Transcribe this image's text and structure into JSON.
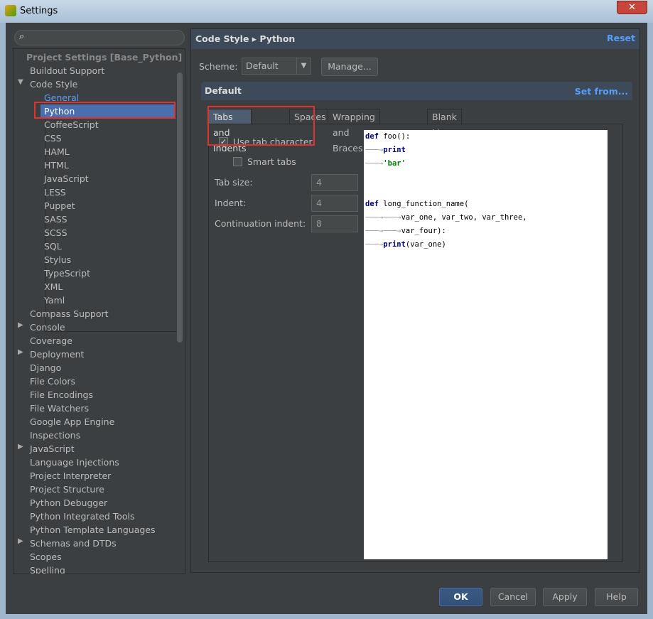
{
  "window": {
    "title": "Settings",
    "close": "✕"
  },
  "sidebar": {
    "search_placeholder": "",
    "section": "Project Settings [Base_Python]",
    "items_top": [
      {
        "label": "Buildout Support",
        "arrow": ""
      },
      {
        "label": "Code Style",
        "arrow": "▼"
      }
    ],
    "code_style_children": [
      "General",
      "Python",
      "CoffeeScript",
      "CSS",
      "HAML",
      "HTML",
      "JavaScript",
      "LESS",
      "Puppet",
      "SASS",
      "SCSS",
      "SQL",
      "Stylus",
      "TypeScript",
      "XML",
      "Yaml"
    ],
    "selected": "Python",
    "items_bottom": [
      {
        "label": "Compass Support",
        "arrow": ""
      },
      {
        "label": "Console",
        "arrow": "▶"
      },
      {
        "label": "Coverage",
        "arrow": ""
      },
      {
        "label": "Deployment",
        "arrow": "▶"
      },
      {
        "label": "Django",
        "arrow": ""
      },
      {
        "label": "File Colors",
        "arrow": ""
      },
      {
        "label": "File Encodings",
        "arrow": ""
      },
      {
        "label": "File Watchers",
        "arrow": ""
      },
      {
        "label": "Google App Engine",
        "arrow": ""
      },
      {
        "label": "Inspections",
        "arrow": ""
      },
      {
        "label": "JavaScript",
        "arrow": "▶"
      },
      {
        "label": "Language Injections",
        "arrow": ""
      },
      {
        "label": "Project Interpreter",
        "arrow": ""
      },
      {
        "label": "Project Structure",
        "arrow": ""
      },
      {
        "label": "Python Debugger",
        "arrow": ""
      },
      {
        "label": "Python Integrated Tools",
        "arrow": ""
      },
      {
        "label": "Python Template Languages",
        "arrow": ""
      },
      {
        "label": "Schemas and DTDs",
        "arrow": "▶"
      },
      {
        "label": "Scopes",
        "arrow": ""
      },
      {
        "label": "Spelling",
        "arrow": ""
      }
    ]
  },
  "main": {
    "breadcrumb": "Code Style ▸ Python",
    "reset": "Reset",
    "scheme_label": "Scheme:",
    "scheme_value": "Default",
    "manage": "Manage...",
    "scheme_header": "Default",
    "set_from": "Set from...",
    "tabs": [
      "Tabs and Indents",
      "Spaces",
      "Wrapping and Braces",
      "Blank Lines"
    ],
    "active_tab": "Tabs and Indents",
    "use_tab": {
      "label": "Use tab character",
      "checked": true
    },
    "smart_tabs": {
      "label": "Smart tabs",
      "checked": false
    },
    "fields": [
      {
        "label": "Tab size:",
        "value": "4"
      },
      {
        "label": "Indent:",
        "value": "4"
      },
      {
        "label": "Continuation indent:",
        "value": "8"
      }
    ],
    "preview": [
      [
        {
          "t": "def",
          "c": "kw"
        },
        {
          "t": " foo():",
          "c": ""
        }
      ],
      [
        {
          "t": "───→",
          "c": "tabmark"
        },
        {
          "t": "print",
          "c": "kw"
        }
      ],
      [
        {
          "t": "───→",
          "c": "tabmark"
        },
        {
          "t": "'bar'",
          "c": "str"
        }
      ],
      [],
      [],
      [
        {
          "t": "def",
          "c": "kw"
        },
        {
          "t": " long_function_name(",
          "c": ""
        }
      ],
      [
        {
          "t": "───→───→",
          "c": "tabmark"
        },
        {
          "t": "var_one, var_two, var_three,",
          "c": ""
        }
      ],
      [
        {
          "t": "───→───→",
          "c": "tabmark"
        },
        {
          "t": "var_four):",
          "c": ""
        }
      ],
      [
        {
          "t": "───→",
          "c": "tabmark"
        },
        {
          "t": "print",
          "c": "kw"
        },
        {
          "t": "(var_one)",
          "c": ""
        }
      ]
    ]
  },
  "footer": {
    "ok": "OK",
    "cancel": "Cancel",
    "apply": "Apply",
    "help": "Help"
  },
  "colors": {
    "accent": "#4b6eaf",
    "link": "#589df6",
    "highlight": "#e0322e",
    "bg": "#3c3f41"
  }
}
